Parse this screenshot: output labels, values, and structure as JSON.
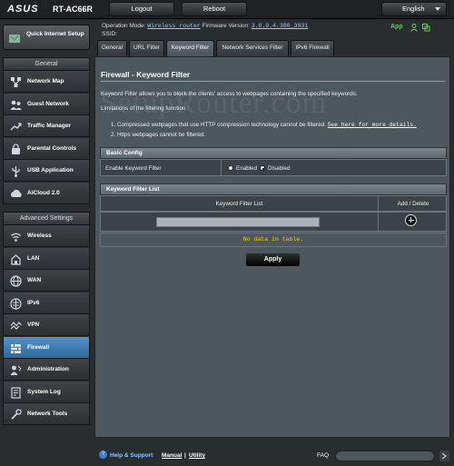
{
  "header": {
    "brand": "ASUS",
    "model": "RT-AC66R",
    "logout_label": "Logout",
    "reboot_label": "Reboot",
    "language": "English"
  },
  "info": {
    "operation_mode_label": "Operation Mode:",
    "operation_mode_value": "Wireless router",
    "firmware_label": "Firmware Version:",
    "firmware_value": "3.0.0.4.380_3831",
    "ssid_label": "SSID:",
    "app_label": "App"
  },
  "sidebar": {
    "quick_setup": "Quick Internet Setup",
    "general_header": "General",
    "general_items": [
      {
        "label": "Network Map",
        "icon": "network-map-icon"
      },
      {
        "label": "Guest Network",
        "icon": "guest-network-icon"
      },
      {
        "label": "Traffic Manager",
        "icon": "traffic-manager-icon"
      },
      {
        "label": "Parental Controls",
        "icon": "parental-controls-icon"
      },
      {
        "label": "USB Application",
        "icon": "usb-application-icon"
      },
      {
        "label": "AiCloud 2.0",
        "icon": "aicloud-icon"
      }
    ],
    "advanced_header": "Advanced Settings",
    "advanced_items": [
      {
        "label": "Wireless",
        "icon": "wireless-icon"
      },
      {
        "label": "LAN",
        "icon": "lan-icon"
      },
      {
        "label": "WAN",
        "icon": "wan-icon"
      },
      {
        "label": "IPv6",
        "icon": "ipv6-icon"
      },
      {
        "label": "VPN",
        "icon": "vpn-icon"
      },
      {
        "label": "Firewall",
        "icon": "firewall-icon",
        "active": true
      },
      {
        "label": "Administration",
        "icon": "administration-icon"
      },
      {
        "label": "System Log",
        "icon": "system-log-icon"
      },
      {
        "label": "Network Tools",
        "icon": "network-tools-icon"
      }
    ]
  },
  "tabs": [
    "General",
    "URL Filter",
    "Keyword Filter",
    "Network Services Filter",
    "IPv6 Firewall"
  ],
  "main": {
    "title": "Firewall - Keyword Filter",
    "description": "Keyword Filter allows you to block the clients' access to webpages containing the specified keywords.",
    "limitations_label": "Limitations of the filtering function :",
    "limitation_1": "1.  Compressed webpages that use HTTP compression technology cannot be filtered.",
    "limitation_1_link": "See here for more details.",
    "limitation_2": "2.  Https webpages cannot be filtered.",
    "basic_config_header": "Basic Config",
    "enable_label": "Enable Keyword Filter",
    "enabled_label": "Enabled",
    "disabled_label": "Disabled",
    "keyword_list_header": "Keyword Filter List",
    "col_keyword": "Keyword Filter List",
    "col_add_delete": "Add / Delete",
    "no_data": "No data in table.",
    "apply_label": "Apply",
    "watermark": "SetupRouter.com"
  },
  "footer": {
    "help": "Help & Support",
    "manual": "Manual",
    "separator": "|",
    "utility": "Utility",
    "faq": "FAQ"
  },
  "colors": {
    "active_nav": "#2d6aa0",
    "no_data_text": "#ffcc00",
    "link": "#8ec6ff"
  }
}
